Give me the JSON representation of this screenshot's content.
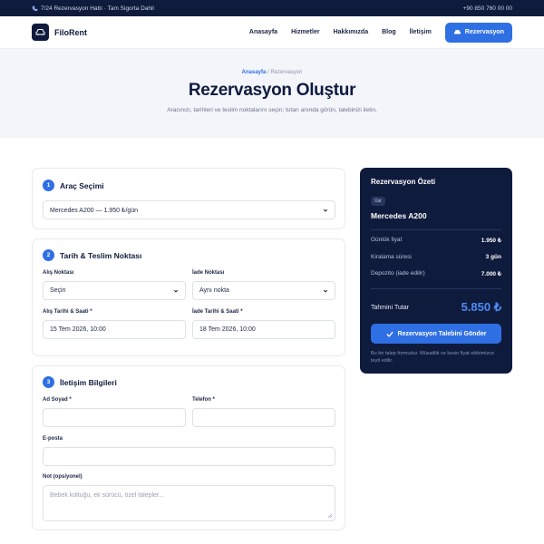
{
  "topbar": {
    "support_text": "7/24 Rezervasyon Hattı · Tam Sigorta Dahil",
    "phone": "+90 850 760 00 00"
  },
  "nav": {
    "brand": "FiloRent",
    "items": [
      "Anasayfa",
      "Hizmetler",
      "Hakkımızda",
      "Blog",
      "İletişim"
    ],
    "cta": "Rezervasyon"
  },
  "hero": {
    "breadcrumb_home": "Anasayfa",
    "breadcrumb_sep": "/",
    "breadcrumb_current": "Rezervasyon",
    "title": "Rezervasyon Oluştur",
    "subtitle": "Aracınızı, tarihleri ve teslim noktalarını seçin; tutarı anında görün, talebinizi iletin."
  },
  "vehicle": {
    "step": "1",
    "title": "Araç Seçimi",
    "selected": "Mercedes A200 — 1.950 ₺/gün"
  },
  "dates": {
    "step": "2",
    "title": "Tarih & Teslim Noktası",
    "pickup_label": "Alış Noktası",
    "pickup_value": "Seçin",
    "return_label": "İade Noktası",
    "return_value": "Aynı nokta",
    "pickup_date_label": "Alış Tarihi & Saati *",
    "pickup_date_value": "15 Tem 2026, 10:00",
    "return_date_label": "İade Tarihi & Saati *",
    "return_date_value": "18 Tem 2026, 10:00"
  },
  "contact": {
    "step": "3",
    "title": "İletişim Bilgileri",
    "name_label": "Ad Soyad *",
    "name_value": "",
    "phone_label": "Telefon *",
    "phone_value": "",
    "email_label": "E-posta",
    "email_value": "",
    "notes_label": "Not (opsiyonel)",
    "notes_placeholder": "Bebek koltuğu, ek sürücü, özel talepler..."
  },
  "summary": {
    "title": "Rezervasyon Özeti",
    "badge": "Üst",
    "car": "Mercedes A200",
    "rows": [
      {
        "label": "Günlük fiyat",
        "value": "1.950 ₺"
      },
      {
        "label": "Kiralama süresi",
        "value": "3 gün"
      },
      {
        "label": "Depozito (iade edilir)",
        "value": "7.000 ₺"
      }
    ],
    "total_label": "Tahmini Tutar",
    "total_value": "5.850 ₺",
    "submit": "Rezervasyon Talebini Gönder",
    "note": "Bu bir talep formudur. Müsaitlik ve kesin fiyat ekibimizce teyit edilir."
  },
  "colors": {
    "navy": "#0f1b3d",
    "accent": "#2f6fe4",
    "total": "#4d8cf5"
  }
}
